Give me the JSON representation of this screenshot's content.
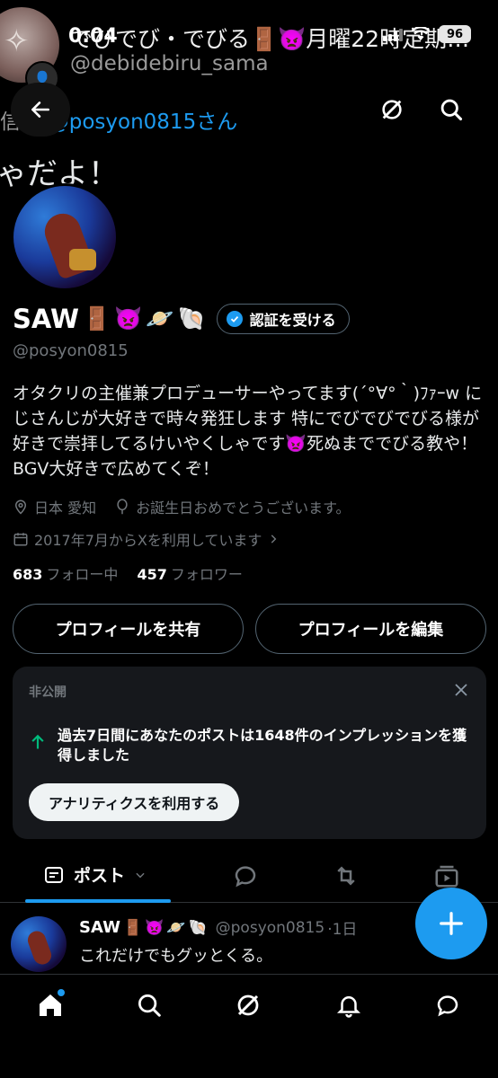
{
  "status": {
    "time": "0:04",
    "battery": "96"
  },
  "background": {
    "name": "でびでび・でびる🚪👿月曜22時定期…",
    "handle": "@debidebiru_sama",
    "reply_prefix": "信先:",
    "reply_mention": "@posyon0815さん",
    "text": "ゃだよ！"
  },
  "profile": {
    "name": "SAW",
    "name_emojis": [
      "🚪",
      "👿",
      "🪐",
      "🐚"
    ],
    "verify_button": "認証を受ける",
    "handle": "@posyon0815",
    "bio": "オタクリの主催兼プロデューサーやってます(´°∀°｀)ﾌｧｰw にじさんじが大好きで時々発狂します 特にでびでびでびる様が好きで崇拝してるけいやくしゃです👿死ぬまででびる教や！ BGV大好きで広めてくぞ！",
    "location": "日本 愛知",
    "birthday": "お誕生日おめでとうございます。",
    "joined": "2017年7月からXを利用しています",
    "following_count": "683",
    "following_label": "フォロー中",
    "followers_count": "457",
    "followers_label": "フォロワー"
  },
  "actions": {
    "share": "プロフィールを共有",
    "edit": "プロフィールを編集"
  },
  "analytics_card": {
    "label": "非公開",
    "message": "過去7日間にあなたのポストは1648件のインプレッションを獲得しました",
    "button": "アナリティクスを利用する",
    "accent_color": "#00ba7c"
  },
  "tabs": {
    "active": "ポスト"
  },
  "post": {
    "name": "SAW",
    "emojis": [
      "🚪",
      "👿",
      "🪐",
      "🐚"
    ],
    "handle": "@posyon0815",
    "time": "·1日",
    "text": "これだけでもグッとくる。"
  },
  "colors": {
    "accent": "#1d9bf0",
    "background": "#000000",
    "muted": "#71767b"
  }
}
